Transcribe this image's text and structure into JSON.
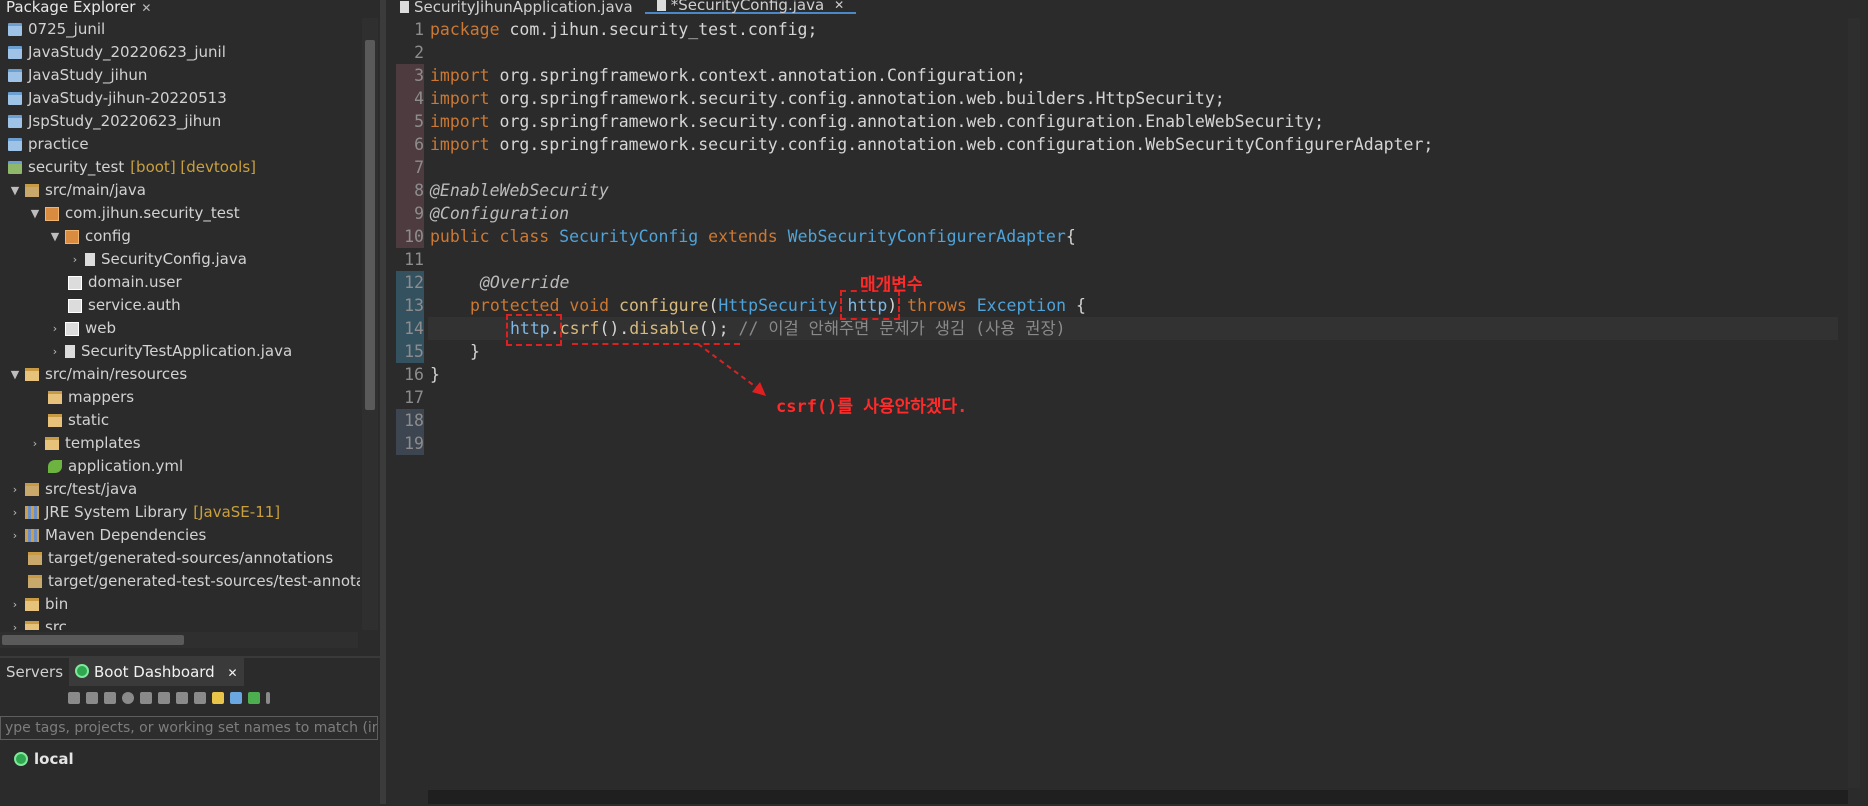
{
  "package_explorer": {
    "tab_label": "Package Explorer",
    "close_glyph": "✕",
    "items": [
      {
        "label": "0725_junil",
        "icon": "project-icon"
      },
      {
        "label": "JavaStudy_20220623_junil",
        "icon": "project-icon"
      },
      {
        "label": "JavaStudy_jihun",
        "icon": "project-icon"
      },
      {
        "label": "JavaStudy-jihun-20220513",
        "icon": "project-icon"
      },
      {
        "label": "JspStudy_20220623_jihun",
        "icon": "project-icon"
      },
      {
        "label": "practice",
        "icon": "project-icon"
      },
      {
        "label": "security_test",
        "decoration": "[boot] [devtools]",
        "icon": "boot-project-icon"
      },
      {
        "label": "src/main/java",
        "icon": "source-folder-icon"
      },
      {
        "label": "com.jihun.security_test",
        "icon": "package-icon"
      },
      {
        "label": "config",
        "icon": "package-icon"
      },
      {
        "label": "SecurityConfig.java",
        "icon": "java-file-icon"
      },
      {
        "label": "domain.user",
        "icon": "package-icon"
      },
      {
        "label": "service.auth",
        "icon": "package-icon"
      },
      {
        "label": "web",
        "icon": "package-icon"
      },
      {
        "label": "SecurityTestApplication.java",
        "icon": "java-file-icon"
      },
      {
        "label": "src/main/resources",
        "icon": "resource-folder-icon"
      },
      {
        "label": "mappers",
        "icon": "folder-icon"
      },
      {
        "label": "static",
        "icon": "folder-icon"
      },
      {
        "label": "templates",
        "icon": "folder-icon"
      },
      {
        "label": "application.yml",
        "icon": "yml-file-icon"
      },
      {
        "label": "src/test/java",
        "icon": "source-folder-icon"
      },
      {
        "label": "JRE System Library",
        "decoration": "[JavaSE-11]",
        "icon": "library-icon"
      },
      {
        "label": "Maven Dependencies",
        "icon": "library-icon"
      },
      {
        "label": "target/generated-sources/annotations",
        "icon": "source-folder-icon"
      },
      {
        "label": "target/generated-test-sources/test-annotations",
        "icon": "source-folder-icon"
      },
      {
        "label": "bin",
        "icon": "folder-icon"
      },
      {
        "label": "src",
        "icon": "folder-icon"
      }
    ]
  },
  "servers": {
    "tab_servers": "Servers",
    "tab_boot_dashboard": "Boot Dashboard",
    "close_glyph": "✕",
    "filter_placeholder": "ype tags, projects, or working set names to match (incl.",
    "local_label": "local"
  },
  "editor": {
    "tabs": [
      {
        "label": "SecurityJihunApplication.java",
        "active": false
      },
      {
        "label": "*SecurityConfig.java",
        "active": true
      }
    ],
    "close_glyph": "✕",
    "line_numbers": [
      "1",
      "2",
      "3",
      "4",
      "5",
      "6",
      "7",
      "8",
      "9",
      "10",
      "11",
      "12",
      "13",
      "14",
      "15",
      "16",
      "17",
      "18",
      "19"
    ],
    "code": {
      "l1_kw": "package",
      "l1_rest": " com.jihun.security_test.config;",
      "import_kw": "import",
      "l3": " org.springframework.context.annotation.Configuration;",
      "l4": " org.springframework.security.config.annotation.web.builders.HttpSecurity;",
      "l5": " org.springframework.security.config.annotation.web.configuration.EnableWebSecurity;",
      "l6": " org.springframework.security.config.annotation.web.configuration.WebSecurityConfigurerAdapter;",
      "l8": "@EnableWebSecurity",
      "l9": "@Configuration",
      "l10_public": "public",
      "l10_class": "class",
      "l10_name": "SecurityConfig",
      "l10_extends": "extends",
      "l10_super": "WebSecurityConfigurerAdapter",
      "l10_brace": "{",
      "l12": "@Override",
      "l13_protected": "protected",
      "l13_void": "void",
      "l13_method": "configure",
      "l13_open": "(",
      "l13_type": "HttpSecurity",
      "l13_param": "http",
      "l13_close": ")",
      "l13_throws": "throws",
      "l13_exc": "Exception",
      "l13_brace": "{",
      "l14_http": "http",
      "l14_dot1": ".",
      "l14_csrf": "csrf",
      "l14_mid": "().",
      "l14_disable": "disable",
      "l14_end": "();",
      "l14_comment": "// 이걸 안해주면 문제가 생김 (사용 권장)",
      "l15": "}",
      "l16": "}"
    }
  },
  "annotations": {
    "param_label": "매개변수",
    "csrf_label": "csrf()를 사용안하겠다."
  }
}
